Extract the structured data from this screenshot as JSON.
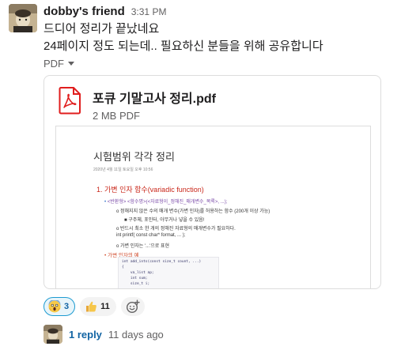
{
  "message": {
    "author": "dobby's friend",
    "time": "3:31 PM",
    "lines": [
      "드디어 정리가 끝났네요",
      "24페이지 정도 되는데.. 필요하신 분들을 위해 공유합니다"
    ]
  },
  "file_toggle": {
    "label": "PDF"
  },
  "file": {
    "name": "포큐 기말고사 정리.pdf",
    "size": "2 MB PDF",
    "icon": "pdf-file-icon",
    "accent": "#e01e1e",
    "preview": {
      "title": "시험범위 각각 정리",
      "date": "2020년 4월 11일 토요일     오후 10:56",
      "section1": "1.  가변 인자 함수(variadic function)",
      "bullet1": "<반환형> <함수명>(<자료형이_정해진_매개변수_목록>, ...);",
      "bullet2": "정해지지 않은 수의 매개 변수(가변 인자)를 허용하는 함수 (200개 이상 가능)",
      "bullet3": "구주체, 포인터, 아무거나 넣을 수 있음!",
      "bullet4": "반드시 최소 한 개의 정해진 자료형의 매개변수가 필요하다.",
      "bullet5": "int printf( const char* format, ... );",
      "bullet6": "가변 인자는 '...'으로 표현",
      "section2": "가변 인자의 예",
      "code": [
        "int add_ints(const size_t count, ...)",
        "{",
        "    va_list ap;",
        "    int sum;",
        "    size_t i;"
      ]
    }
  },
  "reactions": [
    {
      "emoji": "scream-face-icon",
      "count": "3",
      "active": true
    },
    {
      "emoji": "thumbs-up-icon",
      "count": "11",
      "active": false
    }
  ],
  "add_reaction": {
    "icon": "add-reaction-icon"
  },
  "thread": {
    "replies": "1 reply",
    "last_reply": "11 days ago"
  },
  "colors": {
    "link": "#1264a3",
    "muted": "#616061",
    "active_reaction_bg": "#e8f5fa",
    "active_reaction_border": "#1d9bd1"
  }
}
